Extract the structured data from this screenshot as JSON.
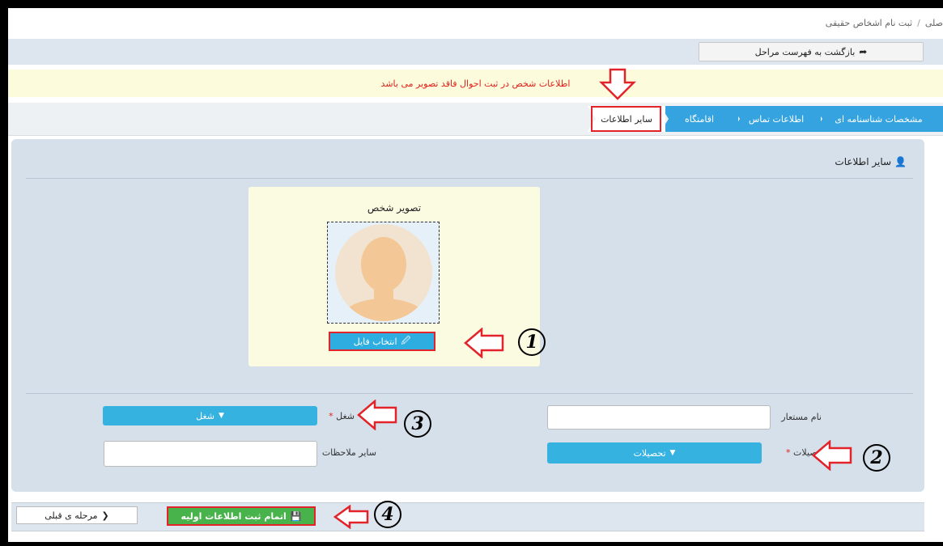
{
  "breadcrumb": {
    "root": "صلی",
    "separator": "/",
    "current": "ثبت نام اشخاص حقیقی"
  },
  "toolbar": {
    "back_label": "بازگشت به فهرست مراحل"
  },
  "alert": {
    "message": "اطلاعات شخص در ثبت احوال فاقد تصویر می باشد"
  },
  "steps": [
    {
      "label": "مشخصات شناسنامه ای",
      "state": "done"
    },
    {
      "label": "اطلاعات تماس",
      "state": "done"
    },
    {
      "label": "اقامتگاه",
      "state": "done"
    },
    {
      "label": "سایر اطلاعات",
      "state": "current"
    }
  ],
  "section": {
    "title": "سایر اطلاعات"
  },
  "photo": {
    "title": "تصویر شخص",
    "choose_file_label": "انتخاب فایل"
  },
  "form": {
    "pseudonym_label": "نام مستعار",
    "pseudonym_value": "",
    "education_label": "تحصیلات",
    "education_value": "تحصیلات",
    "job_label": "شغل",
    "job_value": "شغل",
    "notes_label": "سایر ملاحظات",
    "notes_value": "",
    "required_mark": "*"
  },
  "footer": {
    "prev_label": "مرحله ی قبلی",
    "finish_label": "اتمام ثبت اطلاعات اولیه"
  },
  "annotations": {
    "n1": "1",
    "n2": "2",
    "n3": "3",
    "n4": "4"
  },
  "colors": {
    "accent_blue": "#35a3df",
    "alert_red": "#e0201c",
    "highlight_red": "#e2232a",
    "finish_green": "#48b34a",
    "panel_bg": "#d5e0ea"
  }
}
